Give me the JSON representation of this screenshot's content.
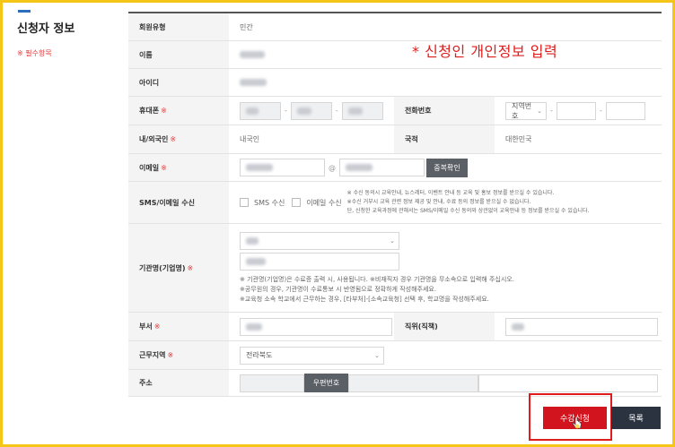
{
  "section": {
    "title": "신청자 정보",
    "required_note": "※ 필수항목"
  },
  "overlay_note": "* 신청인 개인정보 입력",
  "rows": {
    "member_type": {
      "label": "회원유형",
      "value": "민간"
    },
    "name": {
      "label": "이름"
    },
    "user_id": {
      "label": "아이디"
    },
    "mobile": {
      "label": "휴대폰",
      "req": "※"
    },
    "phone": {
      "label": "전화번호",
      "select": "지역번호"
    },
    "nationality_type": {
      "label": "내/외국인",
      "req": "※",
      "value": "내국인"
    },
    "country": {
      "label": "국적",
      "value": "대한민국"
    },
    "email": {
      "label": "이메일",
      "req": "※",
      "at": "@",
      "dup_button": "중복확인"
    },
    "receive": {
      "label": "SMS/이메일 수신",
      "sms": "SMS 수신",
      "email": "이메일 수신",
      "note1": "※ 수신 동의시 교육안내, 뉴스레터, 이벤트 안내 등 교육 및 홍보 정보를 받으실 수 있습니다.",
      "note2": "※수신 거부시 교육 관련 정보 제공 및 안내, 수료 등의 정보를 받으실 수 없습니다.",
      "note3": "단, 신청한 교육과정에 관해서는 SMS/이메일 수신 동의와 상관없이 교육안내 등 정보를 받으실 수 있습니다."
    },
    "org": {
      "label": "기관명(기업명)",
      "req": "※",
      "note1": "※ 기관명(기업명)은 수료증 출력 시, 사용됩니다. ※비재직자 경우 기관명을 무소속으로 입력해 주십시오.",
      "note2": "※공무원의 경우, 기관명이 수료통보 시 반영됨으로 정확하게 작성해주세요.",
      "note3": "※교육청 소속 학교에서 근무하는 경우, [타부처]-[소속교육청] 선택 후, 학교명을 작성해주세요."
    },
    "dept": {
      "label": "부서",
      "req": "※"
    },
    "position": {
      "label": "직위(직책)"
    },
    "region": {
      "label": "근무지역",
      "req": "※",
      "value": "전라북도"
    },
    "address": {
      "label": "주소",
      "zip_button": "우편번호"
    }
  },
  "buttons": {
    "submit": "수강신청",
    "list": "목록"
  },
  "colors": {
    "accent": "#d2141e",
    "required": "#e03a3a",
    "frame": "#f5c518"
  }
}
